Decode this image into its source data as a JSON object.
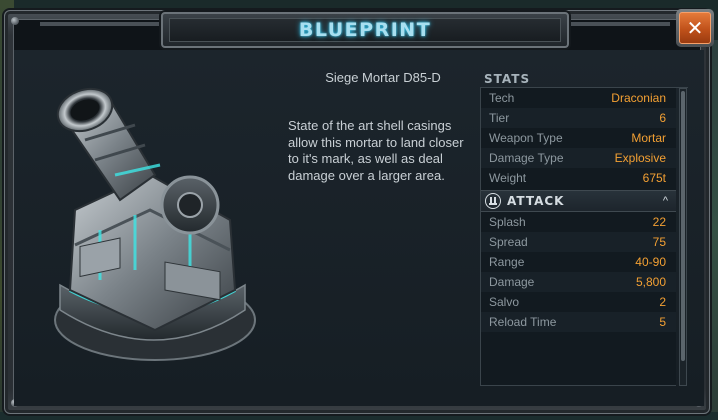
{
  "window": {
    "title": "BLUEPRINT",
    "close_icon": "close-icon",
    "close_glyph": "✕"
  },
  "item": {
    "name": "Siege Mortar D85-D",
    "description": "State of the art shell casings allow this mortar to land closer to it's mark, as well as deal damage over a larger area.",
    "image_icon": "siege-mortar-icon"
  },
  "stats": {
    "header": "STATS",
    "rows": [
      {
        "label": "Tech",
        "value": "Draconian"
      },
      {
        "label": "Tier",
        "value": "6"
      },
      {
        "label": "Weapon Type",
        "value": "Mortar"
      },
      {
        "label": "Damage Type",
        "value": "Explosive"
      },
      {
        "label": "Weight",
        "value": "675t"
      }
    ]
  },
  "attack": {
    "title": "ATTACK",
    "icon": "attack-icon",
    "chevron": "^",
    "rows": [
      {
        "label": "Splash",
        "value": "22"
      },
      {
        "label": "Spread",
        "value": "75"
      },
      {
        "label": "Range",
        "value": "40-90"
      },
      {
        "label": "Damage",
        "value": "5,800"
      },
      {
        "label": "Salvo",
        "value": "2"
      },
      {
        "label": "Reload Time",
        "value": "5"
      }
    ]
  },
  "colors": {
    "accent": "#f3a033",
    "title_glow": "#a8dff0",
    "close": "#c0511a",
    "glow": "#3ee6e6"
  }
}
